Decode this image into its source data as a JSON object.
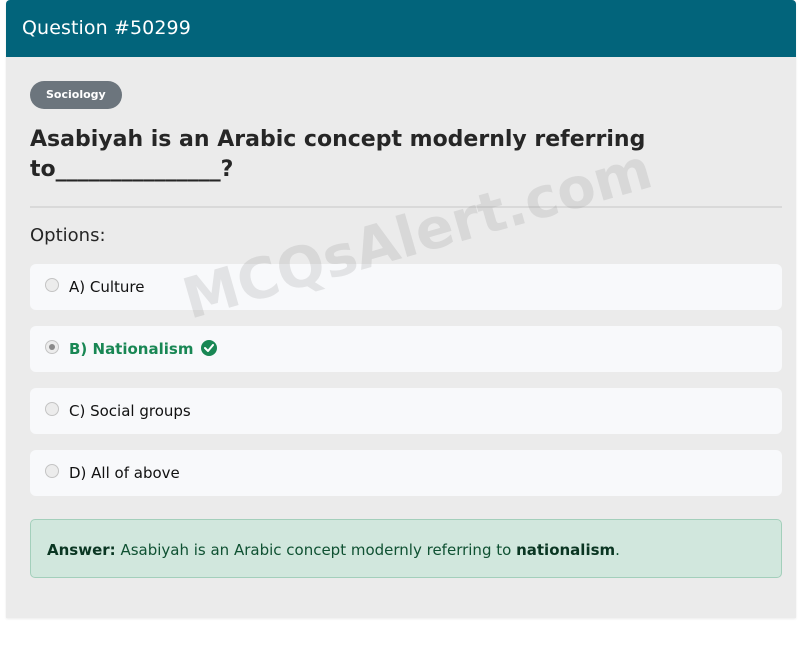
{
  "header": {
    "title": "Question #50299"
  },
  "badge": {
    "label": "Sociology"
  },
  "question": {
    "text": "Asabiyah is an Arabic concept modernly referring to_______________?"
  },
  "options_label": "Options:",
  "options": [
    {
      "label": "A) Culture",
      "selected": false,
      "correct": false
    },
    {
      "label": "B) Nationalism",
      "selected": true,
      "correct": true
    },
    {
      "label": "C) Social groups",
      "selected": false,
      "correct": false
    },
    {
      "label": "D) All of above",
      "selected": false,
      "correct": false
    }
  ],
  "answer": {
    "prefix": "Answer:",
    "text": "Asabiyah is an Arabic concept modernly referring to",
    "highlight": "nationalism",
    "suffix": "."
  },
  "watermark": "MCQsAlert.com",
  "colors": {
    "header": "#02647b",
    "badge": "#6c757d",
    "correct": "#198754",
    "answer_bg": "#d1e7dd"
  }
}
